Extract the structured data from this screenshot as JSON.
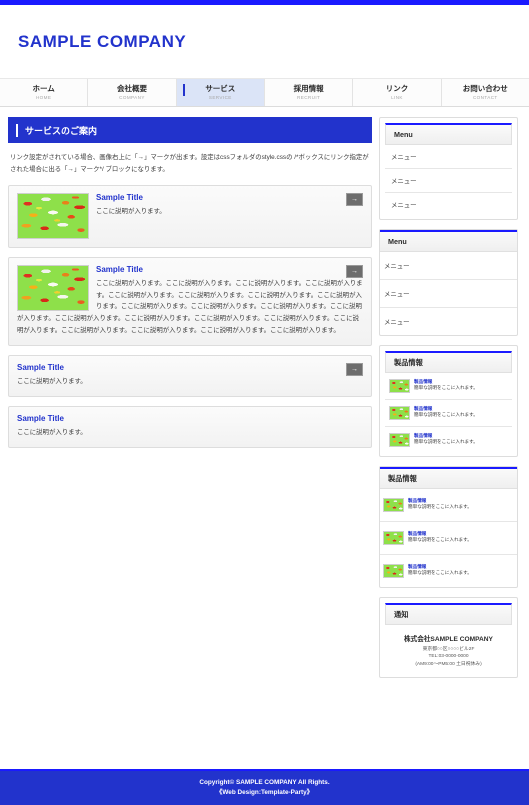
{
  "site": {
    "title": "SAMPLE COMPANY"
  },
  "nav": {
    "items": [
      {
        "ja": "ホーム",
        "en": "HOME",
        "active": false
      },
      {
        "ja": "会社概要",
        "en": "COMPANY",
        "active": false
      },
      {
        "ja": "サービス",
        "en": "SERVICE",
        "active": true
      },
      {
        "ja": "採用情報",
        "en": "RECRUIT",
        "active": false
      },
      {
        "ja": "リンク",
        "en": "LINK",
        "active": false
      },
      {
        "ja": "お問い合わせ",
        "en": "CONTACT",
        "active": false
      }
    ]
  },
  "main": {
    "page_heading": "サービスのご案内",
    "intro": "リンク設定がされている場合、画像右上に「→」マークが出ます。設定はcssフォルダのstyle.cssの /*ボックスにリンク指定がされた場合に出る「→」マーク*/ ブロックになります。",
    "arrow_glyph": "→",
    "boxes": [
      {
        "title": "Sample Title",
        "text": "ここに説明が入ります。",
        "has_image": true,
        "has_arrow": true
      },
      {
        "title": "Sample Title",
        "text": "ここに説明が入ります。ここに説明が入ります。ここに説明が入ります。ここに説明が入ります。ここに説明が入ります。ここに説明が入ります。ここに説明が入ります。ここに説明が入ります。ここに説明が入ります。ここに説明が入ります。ここに説明が入ります。ここに説明が入ります。ここに説明が入ります。ここに説明が入ります。ここに説明が入ります。ここに説明が入ります。ここに説明が入ります。ここに説明が入ります。ここに説明が入ります。ここに説明が入ります。ここに説明が入ります。",
        "has_image": true,
        "has_arrow": true
      },
      {
        "title": "Sample Title",
        "text": "ここに説明が入ります。",
        "has_image": false,
        "has_arrow": true
      },
      {
        "title": "Sample Title",
        "text": "ここに説明が入ります。",
        "has_image": false,
        "has_arrow": false
      }
    ]
  },
  "sidebar": {
    "menu_1": {
      "heading": "Menu",
      "items": [
        "メニュー",
        "メニュー",
        "メニュー"
      ]
    },
    "menu_2": {
      "heading": "Menu",
      "items": [
        "メニュー",
        "メニュー",
        "メニュー"
      ]
    },
    "products_1": {
      "heading": "製品情報",
      "items": [
        {
          "title": "製品情報",
          "desc": "簡単な説明をここに入れます。"
        },
        {
          "title": "製品情報",
          "desc": "簡単な説明をここに入れます。"
        },
        {
          "title": "製品情報",
          "desc": "簡単な説明をここに入れます。"
        }
      ]
    },
    "products_2": {
      "heading": "製品情報",
      "items": [
        {
          "title": "製品情報",
          "desc": "簡単な説明をここに入れます。"
        },
        {
          "title": "製品情報",
          "desc": "簡単な説明をここに入れます。"
        },
        {
          "title": "製品情報",
          "desc": "簡単な説明をここに入れます。"
        }
      ]
    },
    "notice": {
      "heading": "通知",
      "company": "株式会社SAMPLE COMPANY",
      "address": "東京都○○区○○○○ビル2F",
      "tel": "TEL:03-0000-0000",
      "hours": "(AM9:00～PM5:00 土日祝休み)"
    }
  },
  "footer": {
    "line1": "Copyright© SAMPLE COMPANY All Rights.",
    "line2": "《Web Design:Template-Party》"
  },
  "colors": {
    "accent_blue": "#2233cc",
    "bright_blue": "#1a1aff",
    "nav_active_bg": "#dbe4f7",
    "box_border": "#dddddd"
  }
}
